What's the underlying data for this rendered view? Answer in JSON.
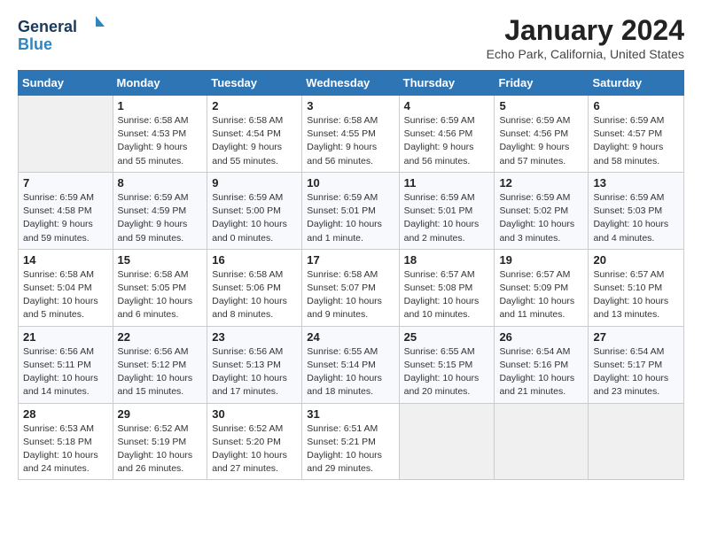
{
  "header": {
    "logo_line1": "General",
    "logo_line2": "Blue",
    "month": "January 2024",
    "location": "Echo Park, California, United States"
  },
  "weekdays": [
    "Sunday",
    "Monday",
    "Tuesday",
    "Wednesday",
    "Thursday",
    "Friday",
    "Saturday"
  ],
  "weeks": [
    [
      {
        "day": "",
        "info": ""
      },
      {
        "day": "1",
        "info": "Sunrise: 6:58 AM\nSunset: 4:53 PM\nDaylight: 9 hours\nand 55 minutes."
      },
      {
        "day": "2",
        "info": "Sunrise: 6:58 AM\nSunset: 4:54 PM\nDaylight: 9 hours\nand 55 minutes."
      },
      {
        "day": "3",
        "info": "Sunrise: 6:58 AM\nSunset: 4:55 PM\nDaylight: 9 hours\nand 56 minutes."
      },
      {
        "day": "4",
        "info": "Sunrise: 6:59 AM\nSunset: 4:56 PM\nDaylight: 9 hours\nand 56 minutes."
      },
      {
        "day": "5",
        "info": "Sunrise: 6:59 AM\nSunset: 4:56 PM\nDaylight: 9 hours\nand 57 minutes."
      },
      {
        "day": "6",
        "info": "Sunrise: 6:59 AM\nSunset: 4:57 PM\nDaylight: 9 hours\nand 58 minutes."
      }
    ],
    [
      {
        "day": "7",
        "info": "Sunrise: 6:59 AM\nSunset: 4:58 PM\nDaylight: 9 hours\nand 59 minutes."
      },
      {
        "day": "8",
        "info": "Sunrise: 6:59 AM\nSunset: 4:59 PM\nDaylight: 9 hours\nand 59 minutes."
      },
      {
        "day": "9",
        "info": "Sunrise: 6:59 AM\nSunset: 5:00 PM\nDaylight: 10 hours\nand 0 minutes."
      },
      {
        "day": "10",
        "info": "Sunrise: 6:59 AM\nSunset: 5:01 PM\nDaylight: 10 hours\nand 1 minute."
      },
      {
        "day": "11",
        "info": "Sunrise: 6:59 AM\nSunset: 5:01 PM\nDaylight: 10 hours\nand 2 minutes."
      },
      {
        "day": "12",
        "info": "Sunrise: 6:59 AM\nSunset: 5:02 PM\nDaylight: 10 hours\nand 3 minutes."
      },
      {
        "day": "13",
        "info": "Sunrise: 6:59 AM\nSunset: 5:03 PM\nDaylight: 10 hours\nand 4 minutes."
      }
    ],
    [
      {
        "day": "14",
        "info": "Sunrise: 6:58 AM\nSunset: 5:04 PM\nDaylight: 10 hours\nand 5 minutes."
      },
      {
        "day": "15",
        "info": "Sunrise: 6:58 AM\nSunset: 5:05 PM\nDaylight: 10 hours\nand 6 minutes."
      },
      {
        "day": "16",
        "info": "Sunrise: 6:58 AM\nSunset: 5:06 PM\nDaylight: 10 hours\nand 8 minutes."
      },
      {
        "day": "17",
        "info": "Sunrise: 6:58 AM\nSunset: 5:07 PM\nDaylight: 10 hours\nand 9 minutes."
      },
      {
        "day": "18",
        "info": "Sunrise: 6:57 AM\nSunset: 5:08 PM\nDaylight: 10 hours\nand 10 minutes."
      },
      {
        "day": "19",
        "info": "Sunrise: 6:57 AM\nSunset: 5:09 PM\nDaylight: 10 hours\nand 11 minutes."
      },
      {
        "day": "20",
        "info": "Sunrise: 6:57 AM\nSunset: 5:10 PM\nDaylight: 10 hours\nand 13 minutes."
      }
    ],
    [
      {
        "day": "21",
        "info": "Sunrise: 6:56 AM\nSunset: 5:11 PM\nDaylight: 10 hours\nand 14 minutes."
      },
      {
        "day": "22",
        "info": "Sunrise: 6:56 AM\nSunset: 5:12 PM\nDaylight: 10 hours\nand 15 minutes."
      },
      {
        "day": "23",
        "info": "Sunrise: 6:56 AM\nSunset: 5:13 PM\nDaylight: 10 hours\nand 17 minutes."
      },
      {
        "day": "24",
        "info": "Sunrise: 6:55 AM\nSunset: 5:14 PM\nDaylight: 10 hours\nand 18 minutes."
      },
      {
        "day": "25",
        "info": "Sunrise: 6:55 AM\nSunset: 5:15 PM\nDaylight: 10 hours\nand 20 minutes."
      },
      {
        "day": "26",
        "info": "Sunrise: 6:54 AM\nSunset: 5:16 PM\nDaylight: 10 hours\nand 21 minutes."
      },
      {
        "day": "27",
        "info": "Sunrise: 6:54 AM\nSunset: 5:17 PM\nDaylight: 10 hours\nand 23 minutes."
      }
    ],
    [
      {
        "day": "28",
        "info": "Sunrise: 6:53 AM\nSunset: 5:18 PM\nDaylight: 10 hours\nand 24 minutes."
      },
      {
        "day": "29",
        "info": "Sunrise: 6:52 AM\nSunset: 5:19 PM\nDaylight: 10 hours\nand 26 minutes."
      },
      {
        "day": "30",
        "info": "Sunrise: 6:52 AM\nSunset: 5:20 PM\nDaylight: 10 hours\nand 27 minutes."
      },
      {
        "day": "31",
        "info": "Sunrise: 6:51 AM\nSunset: 5:21 PM\nDaylight: 10 hours\nand 29 minutes."
      },
      {
        "day": "",
        "info": ""
      },
      {
        "day": "",
        "info": ""
      },
      {
        "day": "",
        "info": ""
      }
    ]
  ]
}
